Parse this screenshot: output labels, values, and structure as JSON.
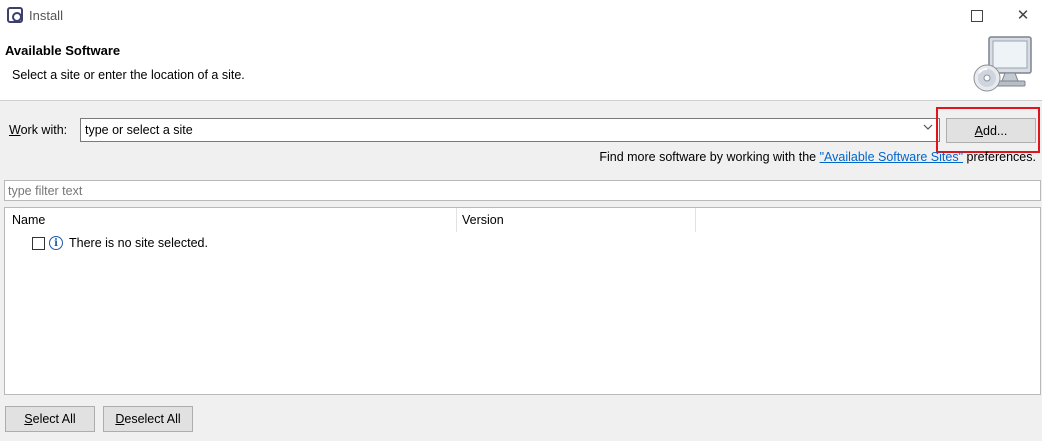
{
  "window": {
    "title": "Install",
    "close_glyph": "✕"
  },
  "header": {
    "title": "Available Software",
    "description": "Select a site or enter the location of a site."
  },
  "work_with": {
    "label_accesskey": "W",
    "label_rest": "ork with:",
    "combo_value": "type or select a site",
    "add_accesskey": "A",
    "add_rest": "dd...",
    "more_prefix": "Find more software by working with the ",
    "more_link": "\"Available Software Sites\"",
    "more_suffix": " preferences."
  },
  "filter": {
    "placeholder": "type filter text"
  },
  "table": {
    "columns": [
      "Name",
      "Version"
    ],
    "empty_message": "There is no site selected."
  },
  "buttons": {
    "select_all_key": "S",
    "select_all_rest": "elect All",
    "deselect_all_key": "D",
    "deselect_all_rest": "eselect All"
  },
  "colors": {
    "highlight": "#e0141c",
    "link": "#0066cc",
    "icon_blue": "#1e5aa8"
  },
  "icons": [
    "eclipse-app-icon",
    "monitor-cd-icon",
    "info-icon",
    "chevron-down-icon",
    "maximize-icon",
    "close-icon"
  ]
}
